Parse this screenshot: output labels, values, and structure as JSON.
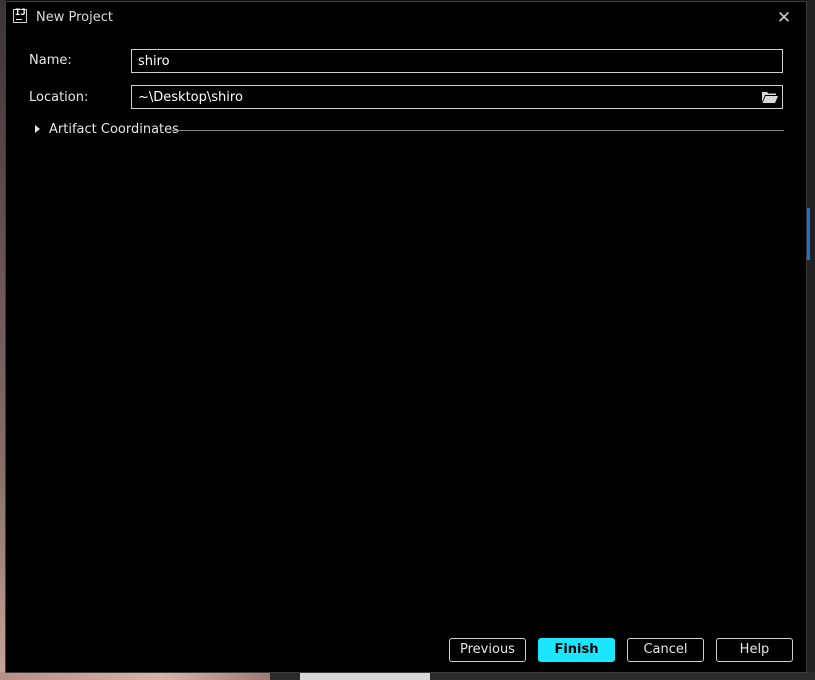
{
  "window": {
    "title": "New Project",
    "app_icon_text": "IJ",
    "close_glyph": "✕"
  },
  "form": {
    "name_label": "Name:",
    "name_value": "shiro",
    "location_label": "Location:",
    "location_value": "~\\Desktop\\shiro",
    "browse_icon": "folder-open-icon"
  },
  "artifact": {
    "label": "Artifact Coordinates",
    "expanded": false
  },
  "buttons": {
    "previous": "Previous",
    "finish": "Finish",
    "cancel": "Cancel",
    "help": "Help"
  },
  "colors": {
    "background": "#000000",
    "accent": "#1ae6ff",
    "text": "#e6e6e6"
  }
}
